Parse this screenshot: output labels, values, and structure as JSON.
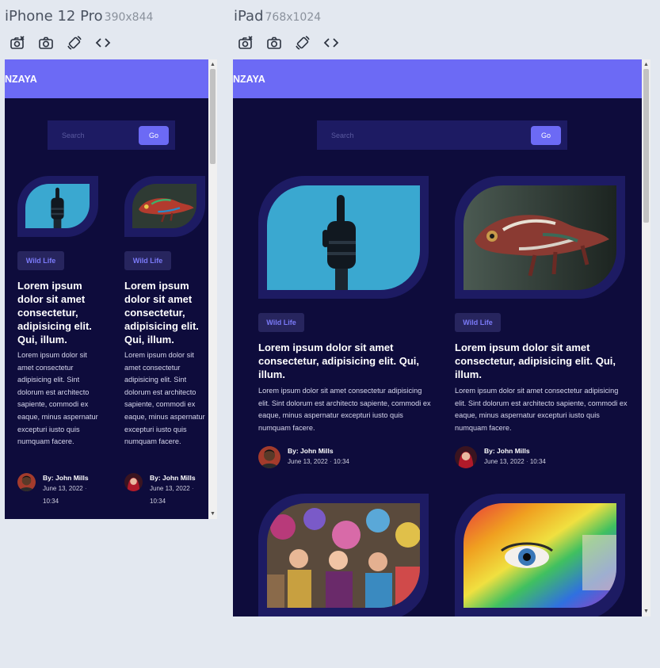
{
  "devices": [
    {
      "name": "iPhone 12 Pro",
      "size": "390x844"
    },
    {
      "name": "iPad",
      "size": "768x1024"
    }
  ],
  "tool_icons": [
    "camera-settings-icon",
    "camera-icon",
    "rotate-device-icon",
    "code-icon"
  ],
  "site": {
    "brand": "NZAYA",
    "search_placeholder": "Search",
    "go_label": "Go"
  },
  "post": {
    "tag": "Wild Life",
    "title": "Lorem ipsum dolor sit amet consectetur, adipisicing elit. Qui, illum.",
    "excerpt": "Lorem ipsum dolor sit amet consectetur adipisicing elit. Sint dolorum est architecto sapiente, commodi ex eaque, minus aspernatur excepturi iusto quis numquam facere.",
    "author": "By: John Mills",
    "date": "June 13, 2022",
    "sep": "·",
    "time": "10:34"
  },
  "colors": {
    "nav": "#6c6af5",
    "background": "#0e0c3c",
    "panel": "#1d1b63",
    "tag_text": "#7b7af8"
  }
}
